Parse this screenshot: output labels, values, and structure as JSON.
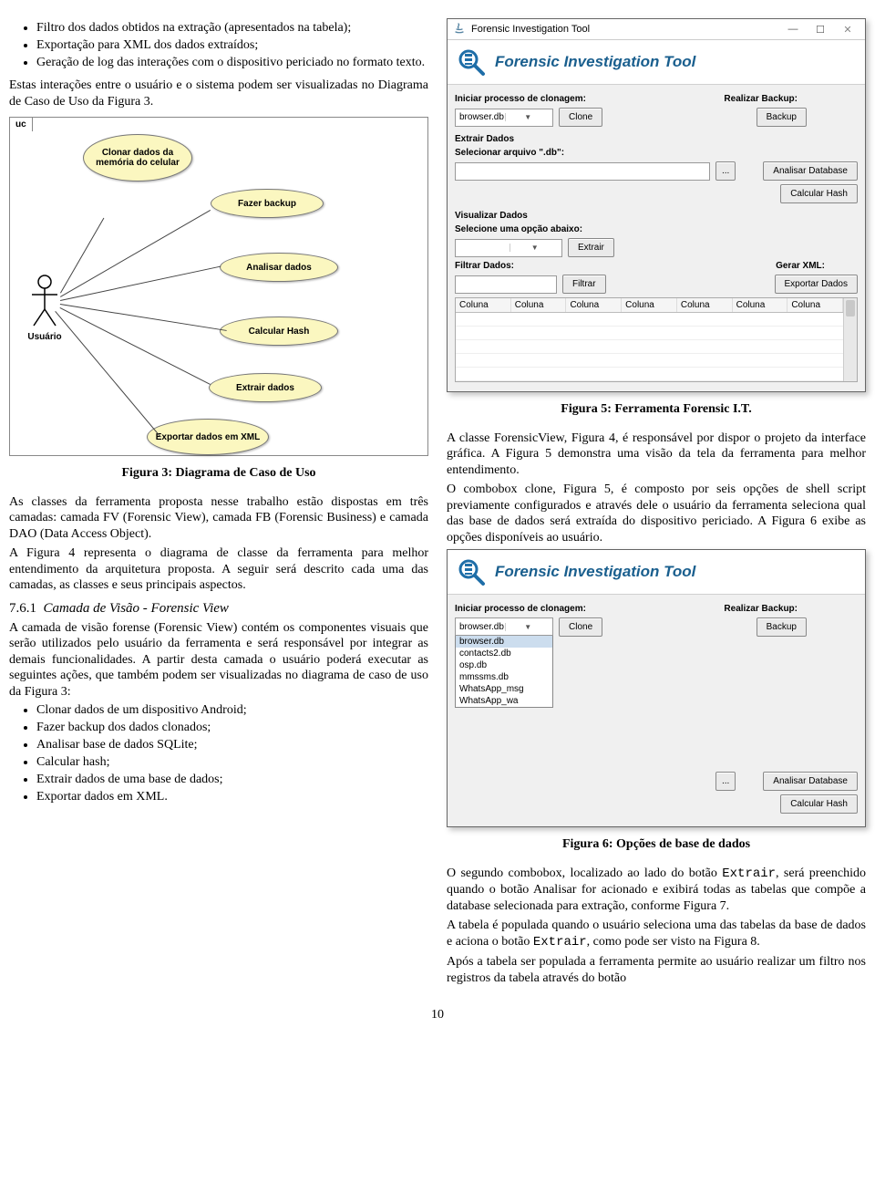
{
  "left": {
    "bullets_top": [
      "Filtro dos dados obtidos na extração (apresentados na tabela);",
      "Exportação para XML dos dados extraídos;",
      "Geração de log das interações com o dispositivo periciado no formato texto."
    ],
    "para_after_bullets": "Estas interações entre o usuário e o sistema podem ser visualizadas no Diagrama de Caso de Uso da Figura 3.",
    "uc": {
      "tab": "uc",
      "actor": "Usuário",
      "nodes": {
        "clone": "Clonar dados da memória do celular",
        "backup": "Fazer backup",
        "analyze": "Analisar dados",
        "hash": "Calcular Hash",
        "extract": "Extrair dados",
        "export": "Exportar dados em XML"
      }
    },
    "fig3": "Figura 3: Diagrama de Caso de Uso",
    "para_fig3": "As classes da ferramenta proposta nesse trabalho estão dispostas em três camadas: camada FV (Forensic View), camada FB (Forensic Business) e camada DAO (Data Access Object).",
    "para_fig4": "A Figura 4 representa o diagrama de classe da ferramenta para melhor entendimento da arquitetura proposta. A seguir será descrito cada uma das camadas, as classes e seus principais aspectos.",
    "sect_761_num": "7.6.1",
    "sect_761_title": "Camada de Visão - Forensic View",
    "para_761": "A camada de visão forense (Forensic View) contém os componentes visuais que serão utilizados pelo usuário da ferramenta e será responsável por integrar as demais funcionalidades. A partir desta camada o usuário poderá executar as seguintes ações, que também podem ser visualizadas no diagrama de caso de uso da Figura 3:",
    "bullets_761": [
      "Clonar dados de um dispositivo Android;",
      "Fazer backup dos dados clonados;",
      "Analisar base de dados SQLite;",
      "Calcular hash;",
      "Extrair dados de uma base de dados;",
      "Exportar dados em XML."
    ]
  },
  "right": {
    "fig5": "Figura 5: Ferramenta Forensic I.T.",
    "para1": "A classe ForensicView, Figura 4, é responsável por dispor o projeto da interface gráfica. A Figura 5 demonstra uma visão da tela da ferramenta para melhor entendimento.",
    "para2": "O combobox clone, Figura 5, é composto por seis opções de shell script previamente configurados e através dele o usuário da ferramenta seleciona qual das base de dados será extraída do dispositivo periciado. A Figura 6 exibe as opções disponíveis ao usuário.",
    "fig6": "Figura 6: Opções de base de dados",
    "para3a": "O segundo combobox, localizado ao lado do botão ",
    "para3_code": "Extrair",
    "para3b": ", será preenchido quando o botão Analisar for acionado e exibirá todas as tabelas que compõe a database selecionada para extração, conforme Figura 7.",
    "para4a": "A tabela é populada quando o usuário seleciona uma das tabelas da base de dados e aciona o botão ",
    "para4_code": "Extrair",
    "para4b": ", como pode ser visto na Figura 8.",
    "para5": "Após a tabela ser populada a ferramenta permite ao usuário realizar um filtro nos registros da tabela através do botão"
  },
  "app": {
    "title": "Forensic Investigation Tool",
    "banner": "Forensic Investigation Tool",
    "lbl_clone": "Iniciar processo de clonagem:",
    "lbl_backup": "Realizar Backup:",
    "combo_clone": "browser.db",
    "btn_clone": "Clone",
    "btn_backup": "Backup",
    "sec_extract": "Extrair Dados",
    "lbl_select_db": "Selecionar arquivo \".db\":",
    "btn_browse": "...",
    "btn_analyze_db": "Analisar Database",
    "btn_calc_hash": "Calcular Hash",
    "sec_view": "Visualizar Dados",
    "lbl_choose_opt": "Selecione uma opção abaixo:",
    "btn_extract": "Extrair",
    "lbl_filter": "Filtrar Dados:",
    "lbl_gen_xml": "Gerar XML:",
    "btn_filter": "Filtrar",
    "btn_export": "Exportar Dados",
    "table_header": "Coluna",
    "dropdown_opts": [
      "browser.db",
      "contacts2.db",
      "osp.db",
      "mmssms.db",
      "WhatsApp_msg",
      "WhatsApp_wa"
    ]
  },
  "page_number": "10"
}
